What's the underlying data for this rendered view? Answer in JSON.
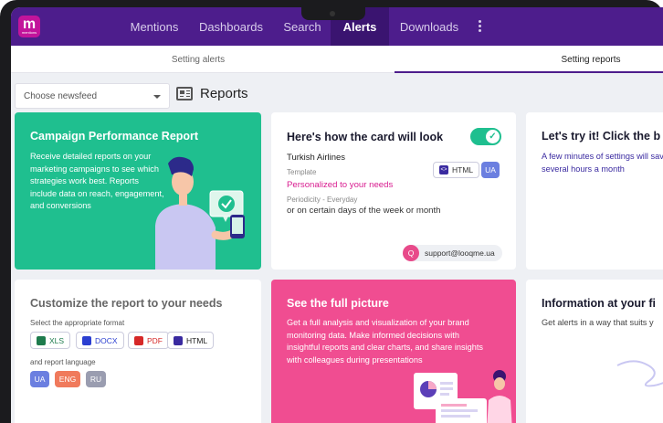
{
  "app": {
    "logo_letter": "m",
    "logo_sub": "mentions"
  },
  "nav": {
    "items": [
      "Mentions",
      "Dashboards",
      "Search",
      "Alerts",
      "Downloads"
    ],
    "active": "Alerts",
    "more_icon": "more-vertical-icon"
  },
  "subtabs": {
    "setting_alerts": "Setting alerts",
    "setting_reports": "Setting reports",
    "active": "Setting reports"
  },
  "toolbar": {
    "newsfeed_placeholder": "Choose newsfeed",
    "section_title": "Reports"
  },
  "cards": {
    "campaign": {
      "title": "Campaign Performance Report",
      "text": "Receive detailed reports on your marketing campaigns to see which strategies work best. Reports include data on reach, engagement, and conversions"
    },
    "preview": {
      "title": "Here's how the card will look",
      "airline": "Turkish Airlines",
      "template_label": "Template",
      "template_value": "Personalized to your needs",
      "periodicity_label": "Periodicity - Everyday",
      "periodicity_value": "or on certain days of the week or month",
      "format": "HTML",
      "language": "UA",
      "email_initial": "Q",
      "email": "support@looqme.ua",
      "toggle_on": true
    },
    "try_it": {
      "title": "Let's try it! Click the b",
      "text": "A few minutes of settings will save you several hours a month"
    },
    "customize": {
      "title": "Customize the report to your needs",
      "format_label": "Select the appropriate format",
      "formats": [
        "XLS",
        "DOCX",
        "PDF",
        "HTML"
      ],
      "language_label": "and report language",
      "languages": [
        "UA",
        "ENG",
        "RU"
      ]
    },
    "full_picture": {
      "title": "See the full picture",
      "text": "Get a full analysis and visualization of your brand monitoring data. Make informed decisions with insightful reports and clear charts, and share insights with colleagues during presentations"
    },
    "info": {
      "title": "Information at your fi",
      "text": "Get alerts in a way that suits y"
    }
  },
  "colors": {
    "nav_bg": "#4d1d8c",
    "green": "#1fbf8f",
    "pink": "#f04d91",
    "accent_text": "#d81b8f"
  }
}
